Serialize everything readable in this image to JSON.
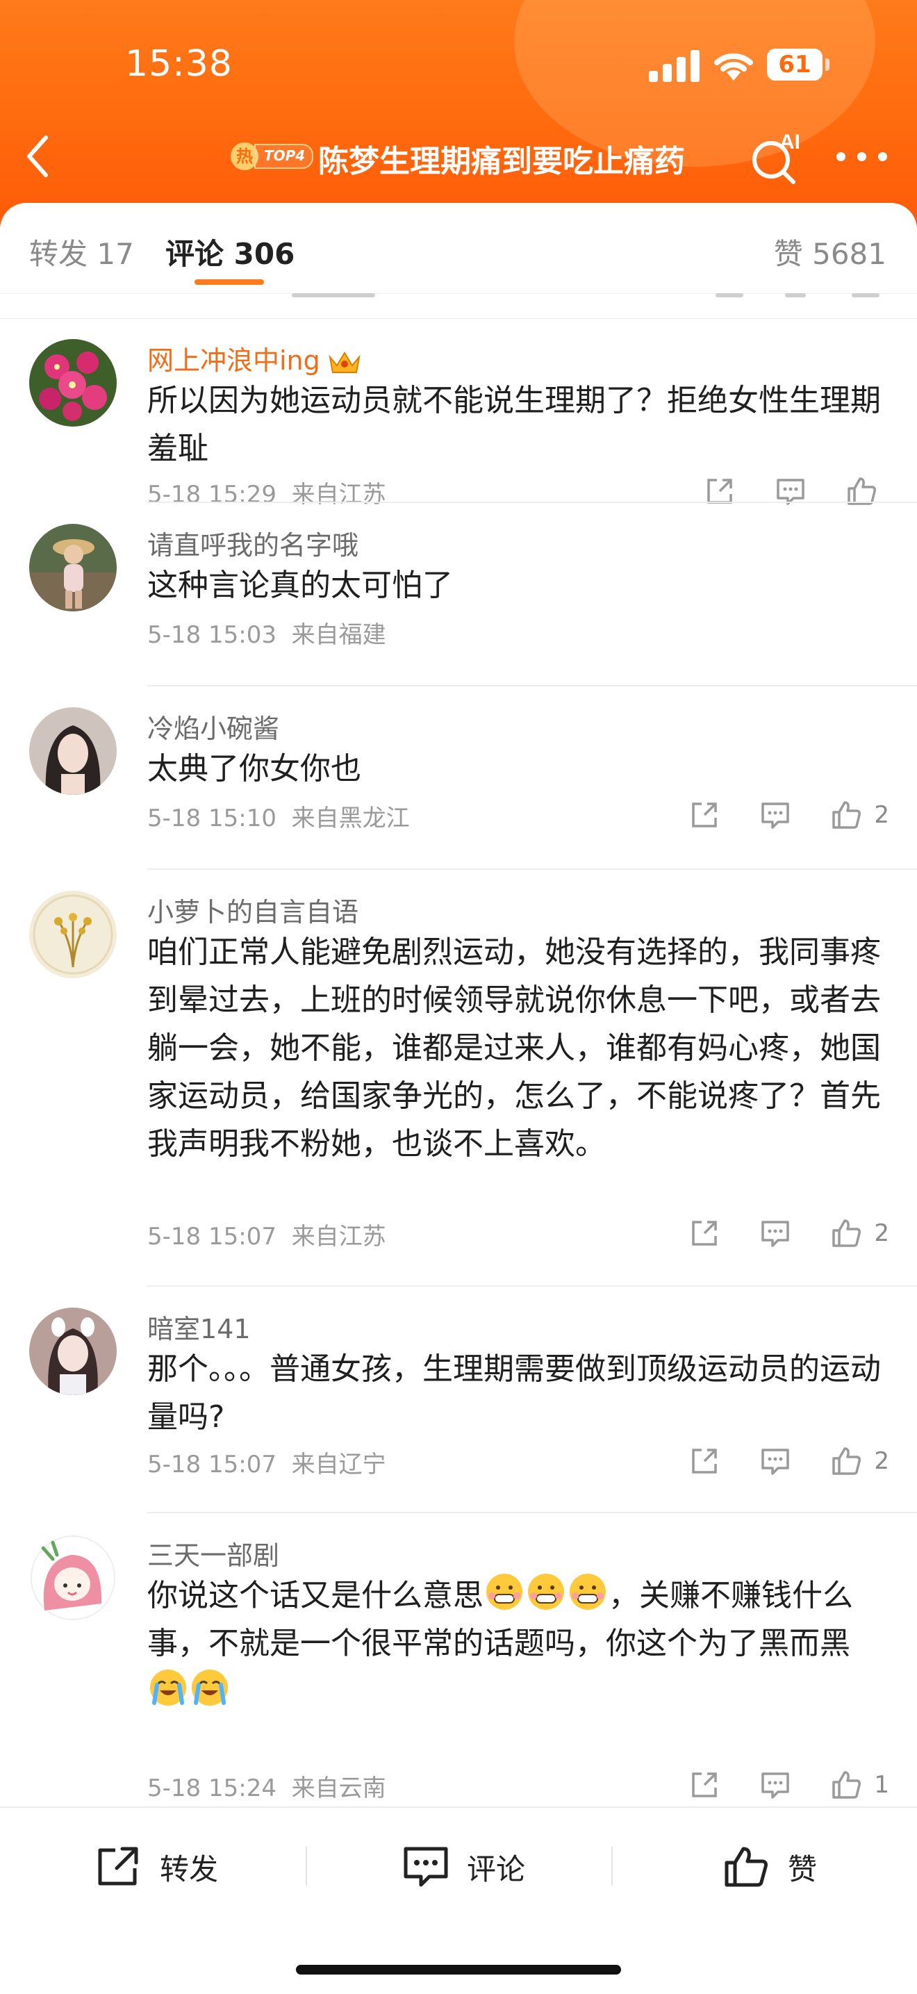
{
  "status_bar": {
    "time": "15:38",
    "battery": "61"
  },
  "header": {
    "hot_char": "热",
    "hot_rank": "TOP4",
    "title": "陈梦生理期痛到要吃止痛药",
    "ai_label": "AI"
  },
  "tabs": {
    "repost": "转发 17",
    "comments": "评论 306",
    "likes": "赞 5681"
  },
  "comments": [
    {
      "user": "网上冲浪中ing",
      "text": "所以因为她运动员就不能说生理期了？拒绝女性生理期羞耻",
      "date": "5-18 15:29",
      "location": "来自江苏",
      "likes": ""
    },
    {
      "user": "请直呼我的名字哦",
      "text": "这种言论真的太可怕了",
      "date": "5-18 15:03",
      "location": "来自福建",
      "likes": ""
    },
    {
      "user": "冷焰小碗酱",
      "text": "太典了你女你也",
      "date": "5-18 15:10",
      "location": "来自黑龙江",
      "likes": "2"
    },
    {
      "user": "小萝卜的自言自语",
      "text": "咱们正常人能避免剧烈运动，她没有选择的，我同事疼到晕过去，上班的时候领导就说你休息一下吧，或者去躺一会，她不能，谁都是过来人，谁都有妈心疼，她国家运动员，给国家争光的，怎么了，不能说疼了？首先我声明我不粉她，也谈不上喜欢。",
      "date": "5-18 15:07",
      "location": "来自江苏",
      "likes": "2"
    },
    {
      "user": "暗室141",
      "text": "那个。。。普通女孩，生理期需要做到顶级运动员的运动量吗?",
      "date": "5-18 15:07",
      "location": "来自辽宁",
      "likes": "2"
    },
    {
      "user": "三天一部剧",
      "text_part1": "你说这个话又是什么意思",
      "text_part2": "，关赚不赚钱什么事，不就是一个很平常的话题吗，你这个为了黑而黑",
      "date": "5-18 15:24",
      "location": "来自云南",
      "likes": "1"
    }
  ],
  "bottom_bar": {
    "repost": "转发",
    "comment": "评论",
    "like": "赞"
  },
  "colors": {
    "accent": "#ff7a1a",
    "vip_name": "#f26d17"
  }
}
